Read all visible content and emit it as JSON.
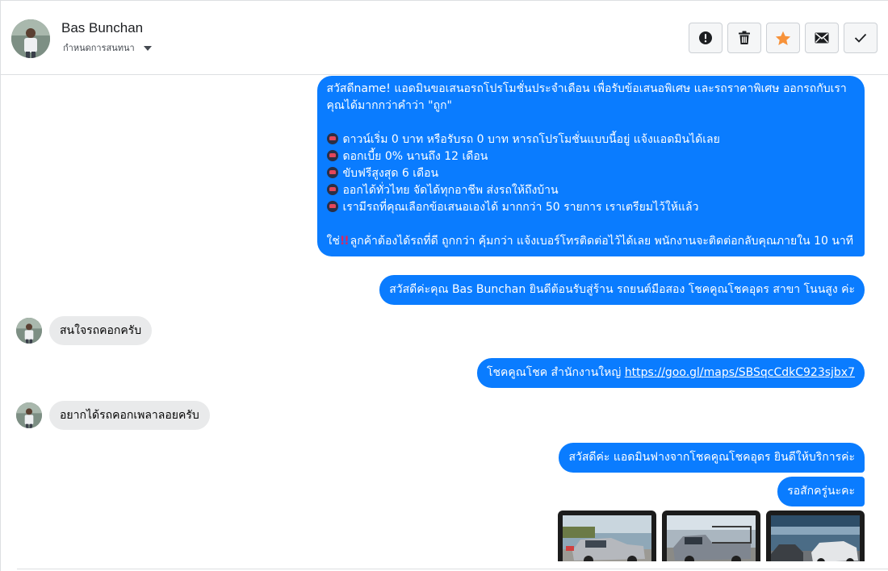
{
  "header": {
    "name": "Bas Bunchan",
    "assign_label": "กำหนดการสนทนา",
    "actions": [
      {
        "icon": "alert-icon"
      },
      {
        "icon": "trash-icon"
      },
      {
        "icon": "star-icon",
        "color": "#f7923a"
      },
      {
        "icon": "mail-icon"
      },
      {
        "icon": "check-icon"
      }
    ]
  },
  "messages": {
    "promo_lines": [
      "สวัสดีname! แอดมินขอเสนอรถโปรโมชั่นประจำเดือน เพื่อรับข้อเสนอพิเศษ และรถราคาพิเศษ ออกรถกับเรา",
      "คุณได้มากกว่าคำว่า \"ถูก\"",
      "ดาวน์เริ่ม 0 บาท หรือรับรถ 0 บาท หารถโปรโมชั่นแบบนี้อยู่ แจ้งแอดมินได้เลย",
      "ดอกเบี้ย 0% นานถึง 12 เดือน",
      "ขับฟรีสูงสุด 6 เดือน",
      "ออกได้ทั่วไทย จัดได้ทุกอาชีพ ส่งรถให้ถึงบ้าน",
      "เรามีรถที่คุณเลือกข้อเสนอเองได้ มากกว่า 50 รายการ เราเตรียมไว้ให้แล้ว",
      "ใช่",
      "ลูกค้าต้องได้รถที่ดี ถูกกว่า คุ้มกว่า แจ้งเบอร์โทรติดต่อไว้ได้เลย พนักงานจะติดต่อกลับคุณภายใน 10 นาที"
    ],
    "welcome": "สวัสดีค่ะคุณ Bas Bunchan ยินดีต้อนรับสู่ร้าน รถยนต์มือสอง โชคคูณโชคอุดร สาขา โนนสูง ค่ะ",
    "in_1": "สนใจรถคอกครับ",
    "branch_prefix": "โชคคูณโชค สำนักงานใหญ่ ",
    "branch_link": "https://goo.gl/maps/SBSqcCdkC923sjbx7",
    "in_2": "อยากได้รถคอกเพลาลอยครับ",
    "greet": "สวัสดีค่ะ แอดมินฟางจากโชคคูณโชคอุดร ยินดีให้บริการค่ะ",
    "wait": "รอสักครู่นะคะ"
  },
  "colors": {
    "outgoing": "#0a7cff",
    "incoming": "#e9eaeb"
  }
}
